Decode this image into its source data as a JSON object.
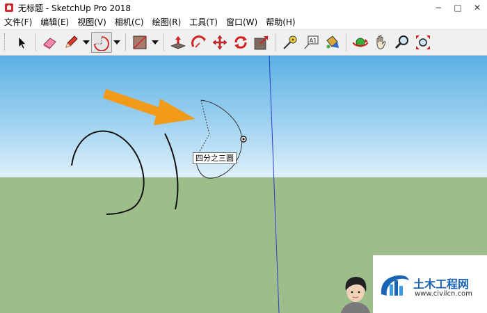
{
  "window": {
    "title": "无标题 - SketchUp Pro 2018",
    "controls": [
      "−",
      "□",
      "✕"
    ]
  },
  "menu": {
    "items": [
      "文件(F)",
      "编辑(E)",
      "视图(V)",
      "相机(C)",
      "绘图(R)",
      "工具(T)",
      "窗口(W)",
      "帮助(H)"
    ]
  },
  "toolbar": {
    "tools": [
      "select-icon",
      "eraser-icon",
      "pencil-icon",
      "arc-icon",
      "rectangle-icon",
      "push-pull-icon",
      "follow-me-icon",
      "move-icon",
      "rotate-icon",
      "scale-icon",
      "tape-measure-icon",
      "text-icon",
      "paint-bucket-icon",
      "orbit-icon",
      "pan-icon",
      "zoom-icon",
      "zoom-extents-icon"
    ],
    "active_tool": "arc-icon",
    "text_tool_label": "A1"
  },
  "viewport": {
    "tooltip": "四分之三圆",
    "colors": {
      "sky_top": "#5bb0e3",
      "ground": "#9dbd8a",
      "arrow": "#f29a1a",
      "axis": "#2a3cc8"
    }
  },
  "watermark": {
    "brand": "土木工程网",
    "url": "www.civilcn.com"
  }
}
